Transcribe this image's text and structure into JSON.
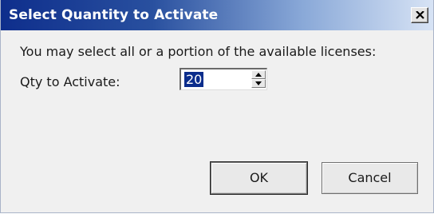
{
  "window": {
    "title": "Select Quantity to Activate",
    "close_glyph": "X"
  },
  "form": {
    "prompt": "You may select all or a portion of the available licenses:",
    "qty_label": "Qty to Activate:",
    "qty_value": "20"
  },
  "buttons": {
    "ok_label": "OK",
    "cancel_label": "Cancel"
  },
  "icons": {
    "close": "close-icon",
    "spin_up": "chevron-up-icon",
    "spin_down": "chevron-down-icon"
  },
  "colors": {
    "titlebar_start": "#0e2e8c",
    "titlebar_end": "#d7e3f5",
    "selection": "#0b2d8c",
    "dialog_bg": "#f0f0f0"
  }
}
